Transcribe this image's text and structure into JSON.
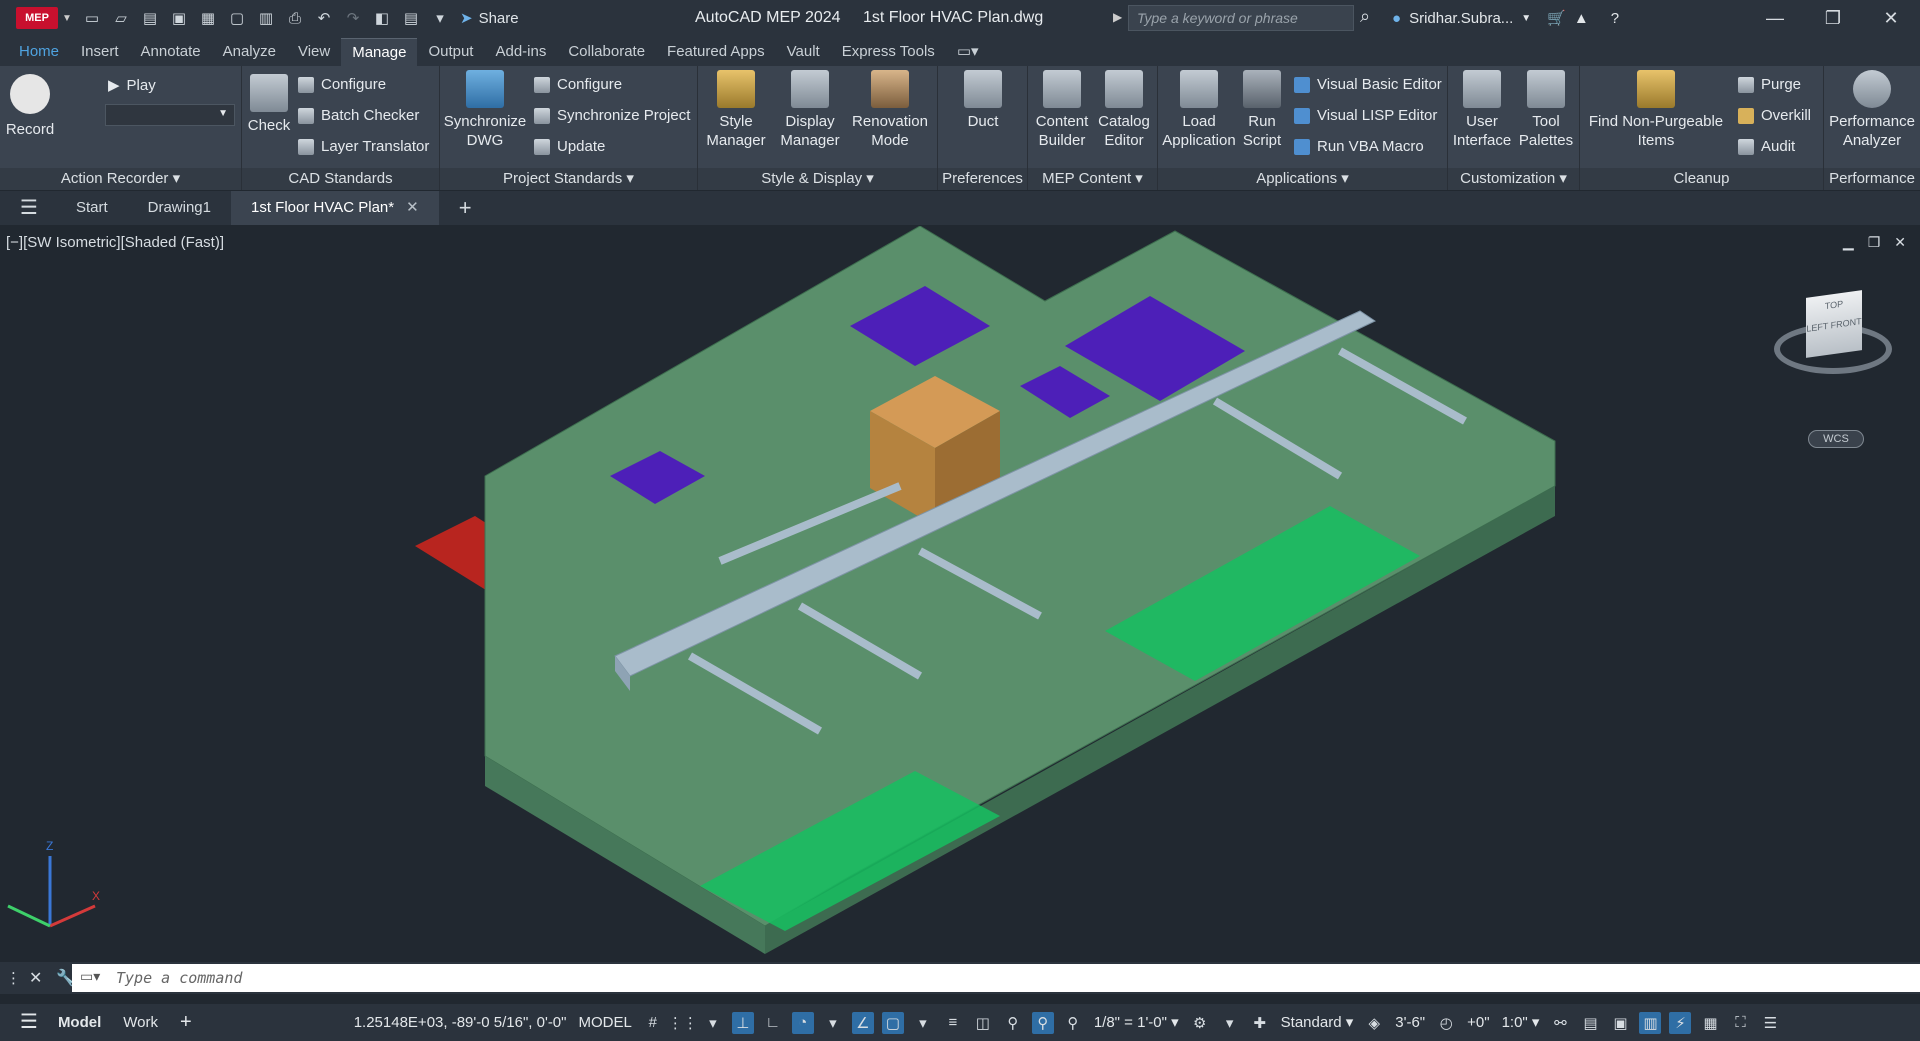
{
  "app": {
    "logo": "MEP",
    "name": "AutoCAD MEP 2024",
    "file": "1st Floor HVAC Plan.dwg",
    "share": "Share"
  },
  "search": {
    "placeholder": "Type a keyword or phrase"
  },
  "user": {
    "name": "Sridhar.Subra..."
  },
  "menu": [
    "Home",
    "Insert",
    "Annotate",
    "Analyze",
    "View",
    "Manage",
    "Output",
    "Add-ins",
    "Collaborate",
    "Featured Apps",
    "Vault",
    "Express Tools"
  ],
  "ribbon": {
    "action_recorder": {
      "title": "Action Recorder",
      "record": "Record",
      "play": "Play"
    },
    "cad_standards": {
      "title": "CAD Standards",
      "check": "Check",
      "configure": "Configure",
      "batch": "Batch Checker",
      "layer": "Layer Translator"
    },
    "project_standards": {
      "title": "Project Standards",
      "sync": "Synchronize DWG",
      "configure": "Configure",
      "syncproj": "Synchronize Project",
      "update": "Update"
    },
    "style_display": {
      "title": "Style & Display",
      "style": "Style Manager",
      "display": "Display Manager",
      "reno": "Renovation Mode"
    },
    "preferences": {
      "title": "Preferences",
      "duct": "Duct"
    },
    "mep_content": {
      "title": "MEP Content",
      "content": "Content Builder",
      "catalog": "Catalog Editor"
    },
    "applications": {
      "title": "Applications",
      "load": "Load Application",
      "run": "Run Script",
      "vbe": "Visual Basic Editor",
      "vlisp": "Visual LISP Editor",
      "vba": "Run VBA Macro"
    },
    "customization": {
      "title": "Customization",
      "cui": "User Interface",
      "palettes": "Tool Palettes"
    },
    "cleanup": {
      "title": "Cleanup",
      "find": "Find Non-Purgeable Items",
      "purge": "Purge",
      "overkill": "Overkill",
      "audit": "Audit"
    },
    "performance": {
      "title": "Performance",
      "analyzer": "Performance Analyzer"
    }
  },
  "filetabs": [
    "Start",
    "Drawing1",
    "1st Floor HVAC Plan*"
  ],
  "viewport": {
    "label": "[−][SW Isometric][Shaded (Fast)]",
    "wcs": "WCS",
    "cube_top": "TOP",
    "cube_left": "LEFT",
    "cube_front": "FRONT"
  },
  "command": {
    "placeholder": "Type a command"
  },
  "status": {
    "model": "Model",
    "work": "Work",
    "coords": "1.25148E+03, -89'-0 5/16\", 0'-0\"",
    "space": "MODEL",
    "scale": "1/8\" = 1'-0\"",
    "style": "Standard",
    "elev": "3'-6\"",
    "offset": "+0\"",
    "ratio": "1:0\""
  },
  "colors": {
    "ribbon": "#3b4450",
    "floor": "#5e9470",
    "duct": "#9fb4c4",
    "accent": "#2f6ea5"
  }
}
